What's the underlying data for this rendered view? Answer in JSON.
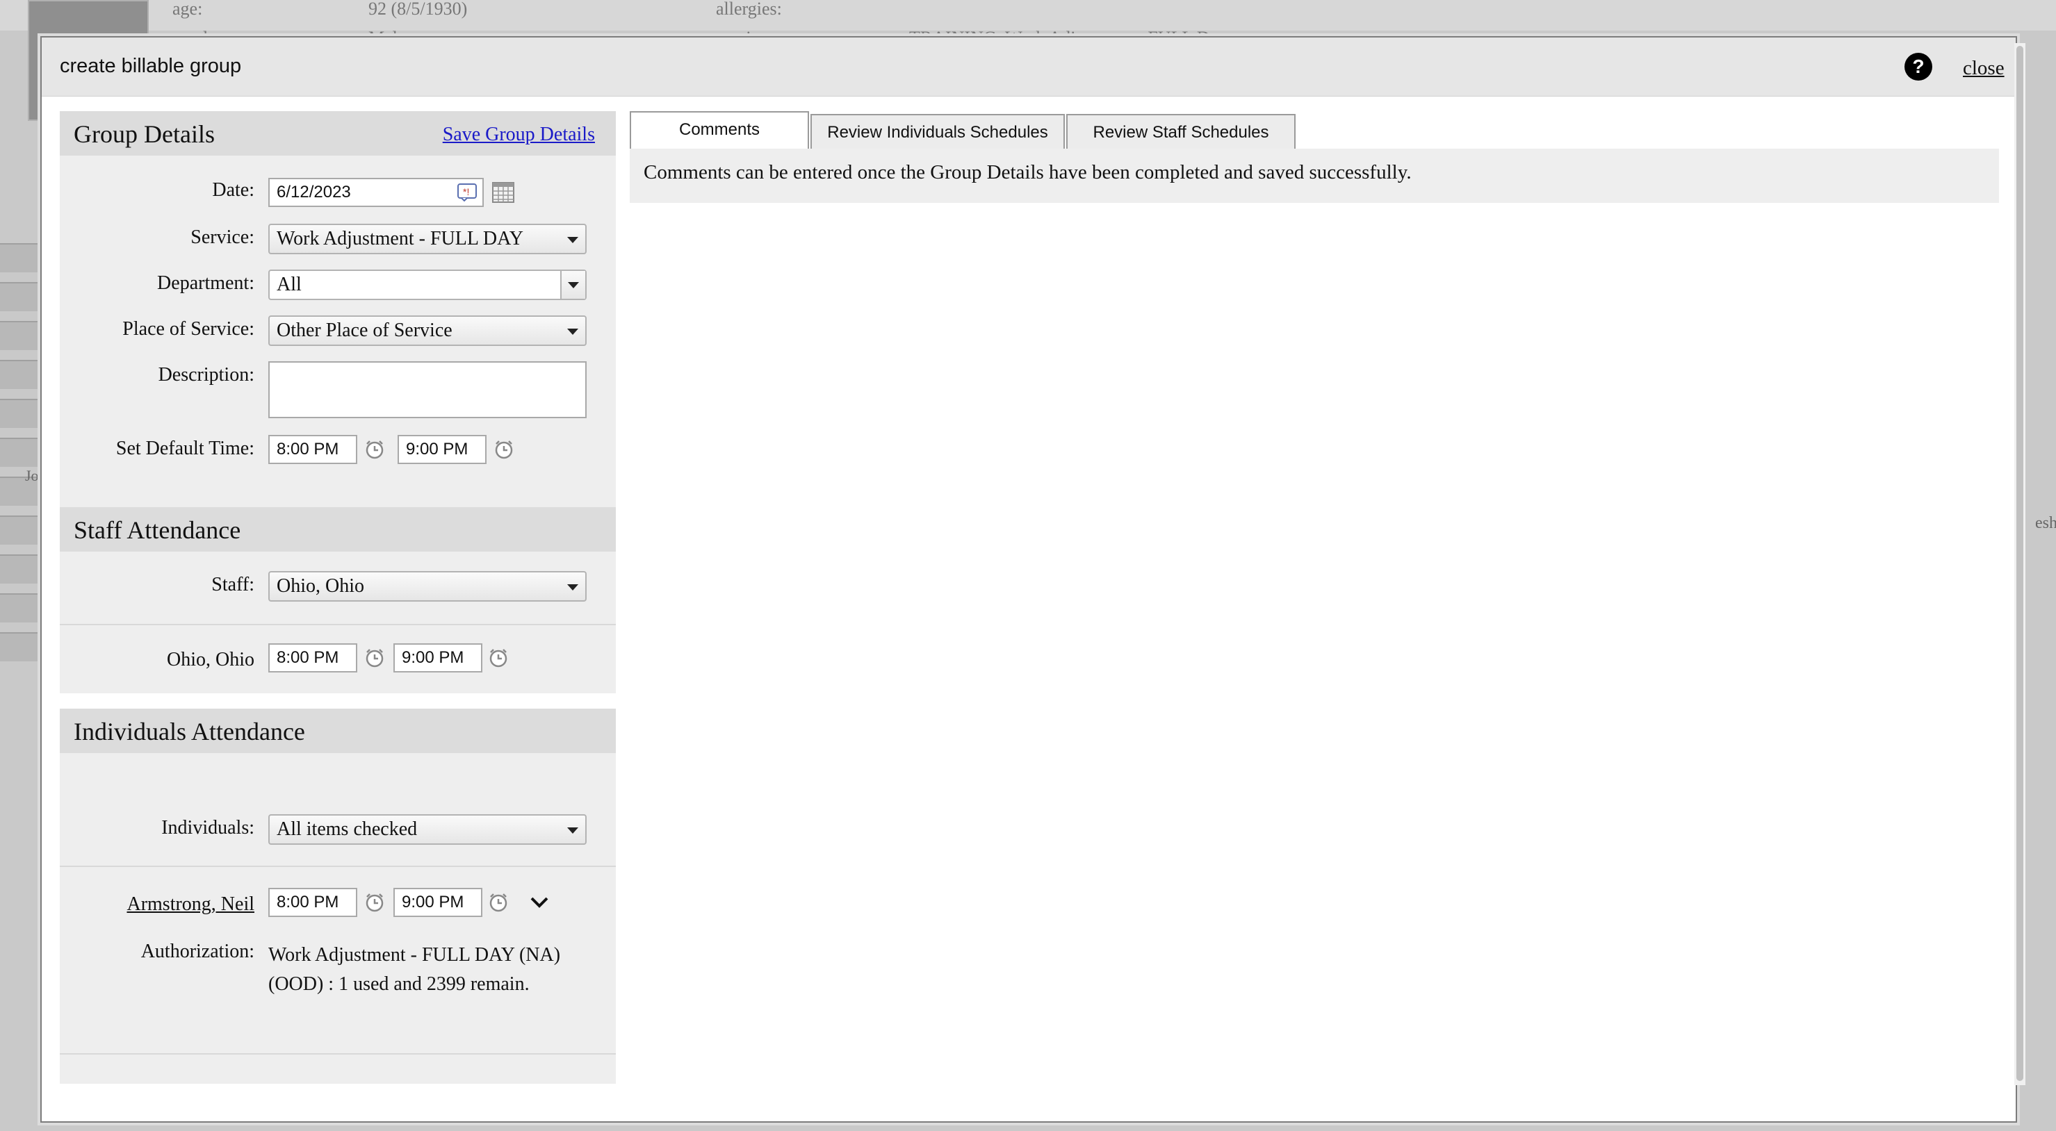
{
  "background": {
    "age_label": "age:",
    "age_value": "92 (8/5/1930)",
    "allergies_label": "allergies:",
    "gender_label": "gender:",
    "gender_value": "Male",
    "services_label": "services:",
    "services_value": "TRAINING, Work Adjustment - FULL D...",
    "left_label": "Jo",
    "right_label": "esh"
  },
  "modal": {
    "title": "create billable group",
    "help_icon_label": "?",
    "close_label": "close"
  },
  "group_details": {
    "heading": "Group Details",
    "save_link": "Save Group Details",
    "date_label": "Date:",
    "date_value": "6/12/2023",
    "service_label": "Service:",
    "service_value": "Work Adjustment - FULL DAY",
    "department_label": "Department:",
    "department_value": "All",
    "place_label": "Place of Service:",
    "place_value": "Other Place of Service",
    "description_label": "Description:",
    "description_value": "",
    "default_time_label": "Set Default Time:",
    "default_start": "8:00 PM",
    "default_end": "9:00 PM"
  },
  "staff_attendance": {
    "heading": "Staff Attendance",
    "staff_label": "Staff:",
    "staff_value": "Ohio, Ohio",
    "entry_name": "Ohio, Ohio",
    "entry_start": "8:00 PM",
    "entry_end": "9:00 PM"
  },
  "individuals_attendance": {
    "heading": "Individuals Attendance",
    "individuals_label": "Individuals:",
    "individuals_value": "All items checked",
    "entry_name": "Armstrong, Neil",
    "entry_start": "8:00 PM",
    "entry_end": "9:00 PM",
    "authorization_label": "Authorization:",
    "authorization_text_line1": "Work Adjustment - FULL DAY (NA)",
    "authorization_text_line2": "(OOD) : 1 used and 2399 remain."
  },
  "tabs": [
    {
      "label": "Comments",
      "active": true
    },
    {
      "label": "Review Individuals Schedules",
      "active": false
    },
    {
      "label": "Review Staff Schedules",
      "active": false
    }
  ],
  "comments": {
    "message": "Comments can be entered once the Group Details have been completed and saved successfully."
  },
  "icons": {
    "help": "help-icon",
    "clock": "clock-icon",
    "calendar": "calendar-icon",
    "date_clear": "date-clear-icon",
    "dropdown": "chevron-down-icon"
  },
  "colors": {
    "link": "#1a1ac8",
    "panel_bg": "#eeeeee",
    "section_head_bg": "#dcdcdc",
    "title_bar_bg": "#e6e6e6"
  }
}
